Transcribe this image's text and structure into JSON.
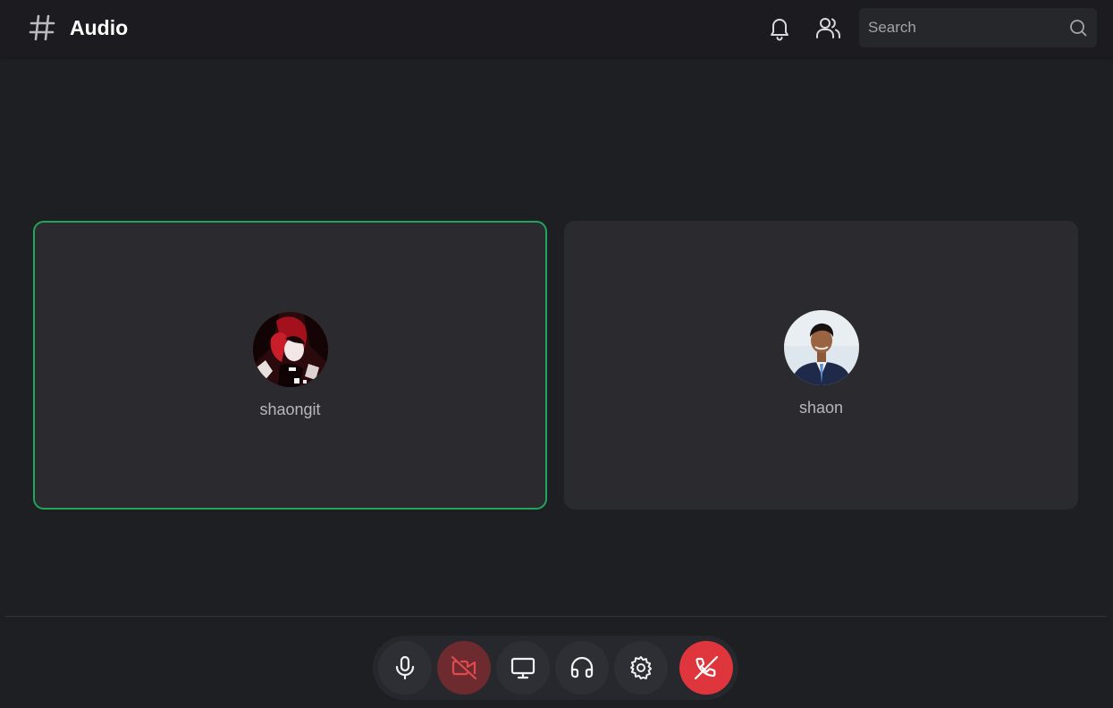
{
  "header": {
    "title": "Audio",
    "search_placeholder": "Search"
  },
  "participants": [
    {
      "name": "shaongit",
      "speaking": true
    },
    {
      "name": "shaon",
      "speaking": false
    }
  ],
  "controls": [
    {
      "icon": "microphone-icon",
      "state": "on"
    },
    {
      "icon": "camera-off-icon",
      "state": "off"
    },
    {
      "icon": "screen-share-icon",
      "state": "idle"
    },
    {
      "icon": "headphones-icon",
      "state": "on"
    },
    {
      "icon": "settings-gear-icon",
      "state": "idle"
    },
    {
      "icon": "phone-hangup-icon",
      "state": "leave"
    }
  ],
  "colors": {
    "speaking_border": "#22a559",
    "leave_button": "#df353c",
    "camera_off_bg": "#6e2b2f",
    "camera_off_icon": "#e04a4f",
    "background": "#1e1f23",
    "tile_background": "#2a2a2f"
  }
}
